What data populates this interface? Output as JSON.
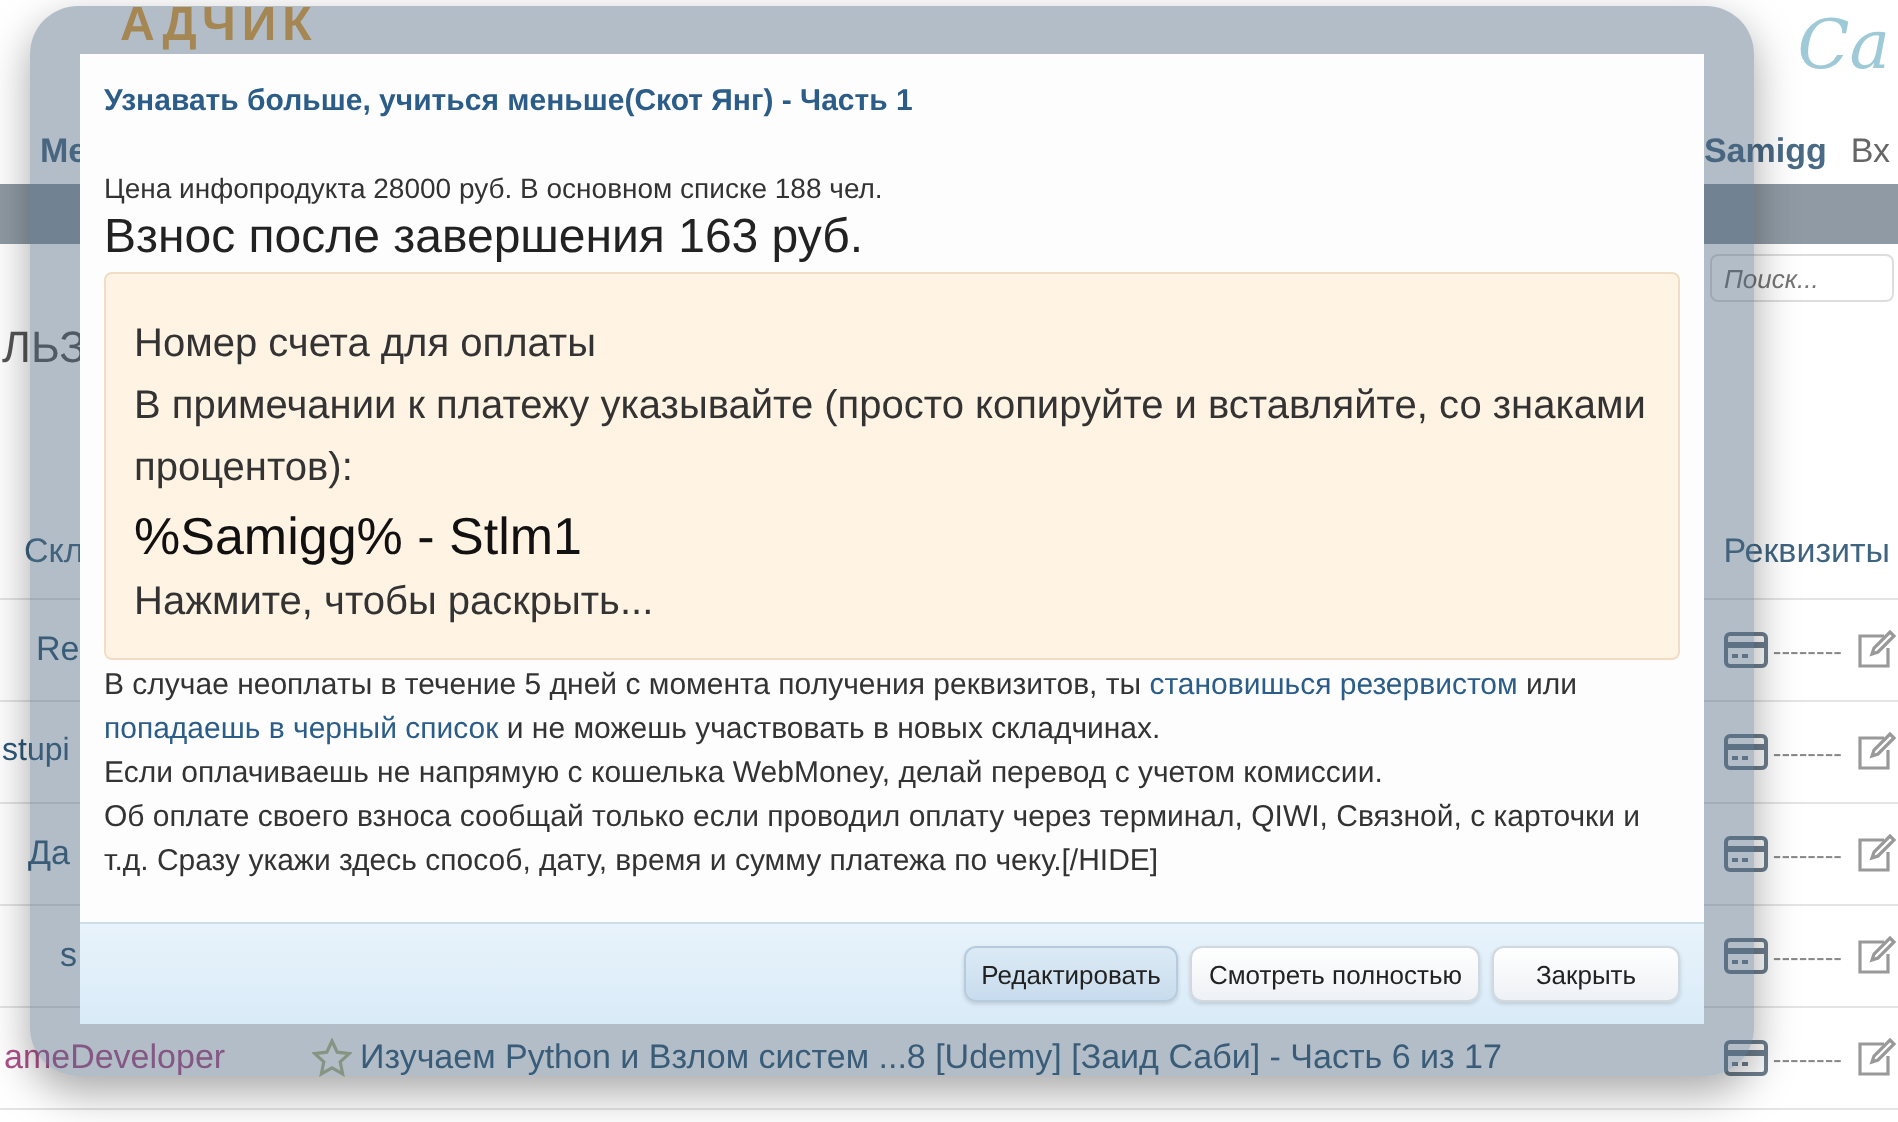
{
  "background": {
    "logo": "АДЧИК",
    "logo_script": "Са",
    "nav": [
      "Ме",
      "Samigg",
      "Вх"
    ],
    "search": {
      "placeholder": "Поиск..."
    },
    "heading": "ЛЬЗ",
    "table": {
      "columns": [
        "Скл",
        "Реквизиты"
      ],
      "rows": [
        {
          "user": "Re",
          "requisites": "--------"
        },
        {
          "user": "stupi",
          "requisites": "--------"
        },
        {
          "user": "Да",
          "requisites": "--------"
        },
        {
          "user": "s",
          "requisites": "--------"
        },
        {
          "user": "ameDeveloper",
          "title": "Изучаем Python и Взлом систем ...8 [Udemy] [Заид Саби] - Часть 6 из 17",
          "requisites": "--------"
        }
      ]
    }
  },
  "dialog": {
    "title": "Узнавать больше, учиться меньше(Скот Янг) - Часть 1",
    "price_line": "Цена инфопродукта 28000 руб. В основном списке 188 чел.",
    "fee": "Взнос после завершения 163 руб.",
    "notice": {
      "lines": [
        "Номер счета для оплаты",
        "В примечании к платежу указывайте (просто копируйте и вставляйте, со знаками процентов):"
      ],
      "code": "%Samigg% - Stlm1",
      "expand": "Нажмите, чтобы раскрыть..."
    },
    "warning": [
      {
        "kind": "text",
        "text": "В случае неоплаты в течение 5 дней с момента получения реквизитов, ты "
      },
      {
        "kind": "link",
        "text": "становишься резервистом"
      },
      {
        "kind": "text",
        "text": " или "
      },
      {
        "kind": "link",
        "text": "попадаешь в черный список"
      },
      {
        "kind": "text",
        "text": " и не можешь участвовать в новых складчинах."
      }
    ],
    "notes": [
      "Если оплачиваешь не напрямую с кошелька WebMoney, делай перевод с учетом комиссии.",
      "Об оплате своего взноса сообщай только если проводил оплату через терминал, QIWI, Связной, с карточки и т.д. Сразу укажи здесь способ, дату, время и сумму платежа по чеку.[/HIDE]"
    ],
    "buttons": [
      {
        "label": "Редактировать",
        "selected": true
      },
      {
        "label": "Смотреть полностью",
        "selected": false
      },
      {
        "label": "Закрыть",
        "selected": false
      }
    ]
  }
}
